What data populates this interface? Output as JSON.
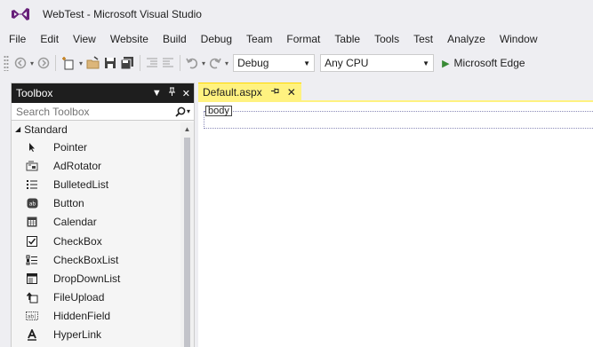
{
  "window": {
    "title": "WebTest - Microsoft Visual Studio",
    "logo_icon": "visual-studio-logo-icon",
    "accent": "#68217a"
  },
  "menu": {
    "items": [
      "File",
      "Edit",
      "View",
      "Website",
      "Build",
      "Debug",
      "Team",
      "Format",
      "Table",
      "Tools",
      "Test",
      "Analyze",
      "Window"
    ]
  },
  "toolbar": {
    "configuration": "Debug",
    "platform": "Any CPU",
    "run_label": "Microsoft Edge",
    "icons": [
      "back-icon",
      "forward-icon",
      "new-project-icon",
      "open-file-icon",
      "save-icon",
      "save-all-icon",
      "indent-icon",
      "outdent-icon",
      "undo-icon",
      "redo-icon",
      "play-icon"
    ]
  },
  "toolbox": {
    "title": "Toolbox",
    "search_placeholder": "Search Toolbox",
    "category": "Standard",
    "items": [
      {
        "label": "Pointer",
        "icon": "pointer-icon"
      },
      {
        "label": "AdRotator",
        "icon": "adrotator-icon"
      },
      {
        "label": "BulletedList",
        "icon": "bulleted-list-icon"
      },
      {
        "label": "Button",
        "icon": "button-icon"
      },
      {
        "label": "Calendar",
        "icon": "calendar-icon"
      },
      {
        "label": "CheckBox",
        "icon": "checkbox-icon"
      },
      {
        "label": "CheckBoxList",
        "icon": "checkbox-list-icon"
      },
      {
        "label": "DropDownList",
        "icon": "dropdown-list-icon"
      },
      {
        "label": "FileUpload",
        "icon": "file-upload-icon"
      },
      {
        "label": "HiddenField",
        "icon": "hidden-field-icon"
      },
      {
        "label": "HyperLink",
        "icon": "hyperlink-icon"
      }
    ]
  },
  "editor": {
    "tab_label": "Default.aspx",
    "tab_color": "#fff280",
    "body_tag": "body"
  }
}
